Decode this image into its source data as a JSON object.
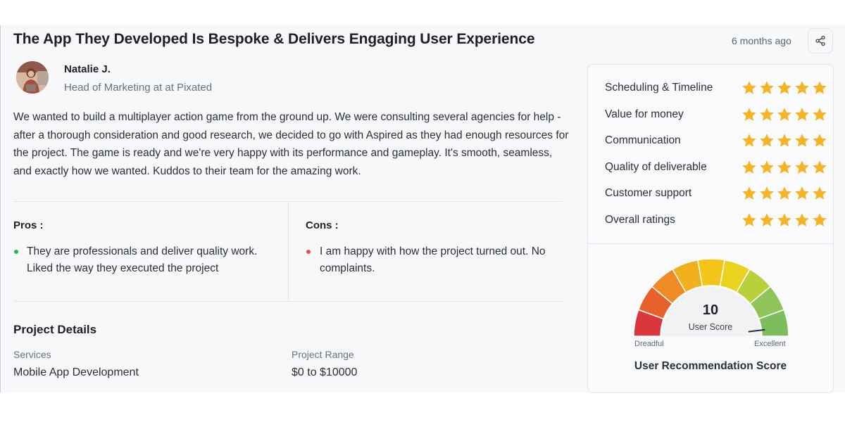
{
  "review": {
    "title": "The App They Developed Is Bespoke & Delivers Engaging User Experience",
    "time_ago": "6 months ago",
    "share_icon": "share-icon",
    "reviewer": {
      "name": "Natalie J.",
      "role": "Head of Marketing at at Pixated"
    },
    "text": "We wanted to build a multiplayer action game from the ground up. We were consulting several agencies for help - after a thorough consideration and good research, we decided to go with Aspired as they had enough resources for the project. The game is ready and we're very happy with its performance and gameplay. It's smooth, seamless, and exactly how we wanted. Kuddos to their team for the amazing work."
  },
  "pros": {
    "heading": "Pros :",
    "items": [
      "They are professionals and deliver quality work. Liked the way they executed the project"
    ],
    "bullet_color": "#2fb344"
  },
  "cons": {
    "heading": "Cons :",
    "items": [
      "I am happy with how the project turned out. No complaints."
    ],
    "bullet_color": "#e5533d"
  },
  "project_details": {
    "heading": "Project Details",
    "services_label": "Services",
    "services_value": "Mobile App Development",
    "range_label": "Project Range",
    "range_value": "$0 to $10000"
  },
  "ratings": {
    "star_color": "#f5b325",
    "max_stars": 5,
    "items": [
      {
        "label": "Scheduling & Timeline",
        "stars": 5
      },
      {
        "label": "Value for money",
        "stars": 5
      },
      {
        "label": "Communication",
        "stars": 5
      },
      {
        "label": "Quality of deliverable",
        "stars": 5
      },
      {
        "label": "Customer support",
        "stars": 5
      },
      {
        "label": "Overall ratings",
        "stars": 5
      }
    ]
  },
  "user_score": {
    "value": "10",
    "score_fraction": 1.0,
    "caption": "User Score",
    "min_label": "Dreadful",
    "max_label": "Excellent",
    "title": "User Recommendation Score",
    "segment_colors": [
      "#d9363e",
      "#e8612c",
      "#f08a24",
      "#f2b01e",
      "#f4c518",
      "#e9d31f",
      "#b9cf3b",
      "#8fc45a",
      "#7cbd5c"
    ]
  }
}
